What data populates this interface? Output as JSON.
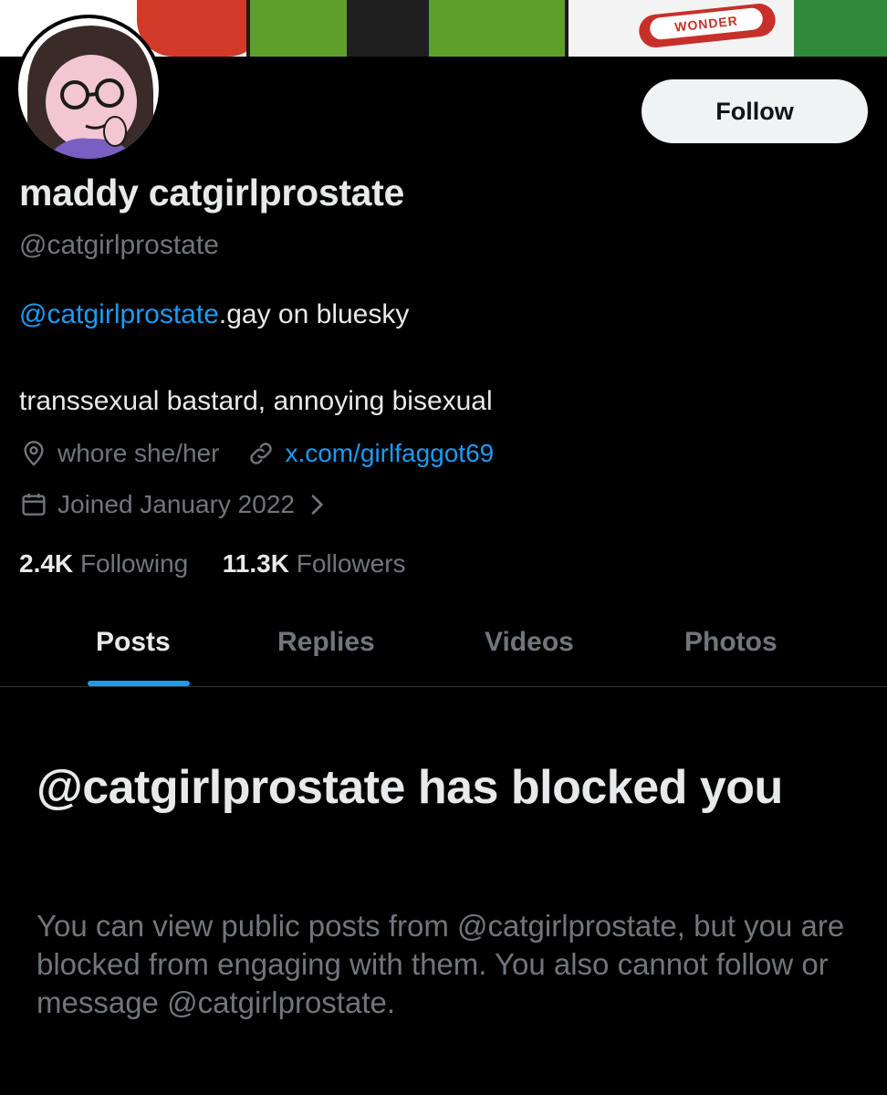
{
  "profile": {
    "display_name": "maddy catgirlprostate",
    "handle": "@catgirlprostate",
    "follow_label": "Follow",
    "bio_mention": "@catgirlprostate",
    "bio_line1_rest": ".gay on bluesky",
    "bio_line2": "transsexual bastard, annoying bisexual",
    "location": "whore she/her",
    "website": "x.com/girlfaggot69",
    "joined": "Joined January 2022",
    "following_count": "2.4K",
    "following_label": "Following",
    "followers_count": "11.3K",
    "followers_label": "Followers"
  },
  "banner": {
    "sign_text": "WONDER"
  },
  "tabs": [
    {
      "label": "Posts",
      "active": true
    },
    {
      "label": "Replies",
      "active": false
    },
    {
      "label": "Videos",
      "active": false
    },
    {
      "label": "Photos",
      "active": false
    }
  ],
  "blocked": {
    "title": "@catgirlprostate has blocked you",
    "body": "You can view public posts from @catgirlprostate, but you are blocked from engaging with them. You also cannot follow or message @catgirlprostate."
  },
  "colors": {
    "background": "#000000",
    "accent": "#1d9bf0",
    "primary_text": "#e7e9ea",
    "secondary_text": "#71767b",
    "follow_button_bg": "#eff3f4"
  },
  "icons": {
    "location": "location-pin-icon",
    "website": "link-icon",
    "joined": "calendar-icon",
    "joined_more": "chevron-right-icon"
  }
}
